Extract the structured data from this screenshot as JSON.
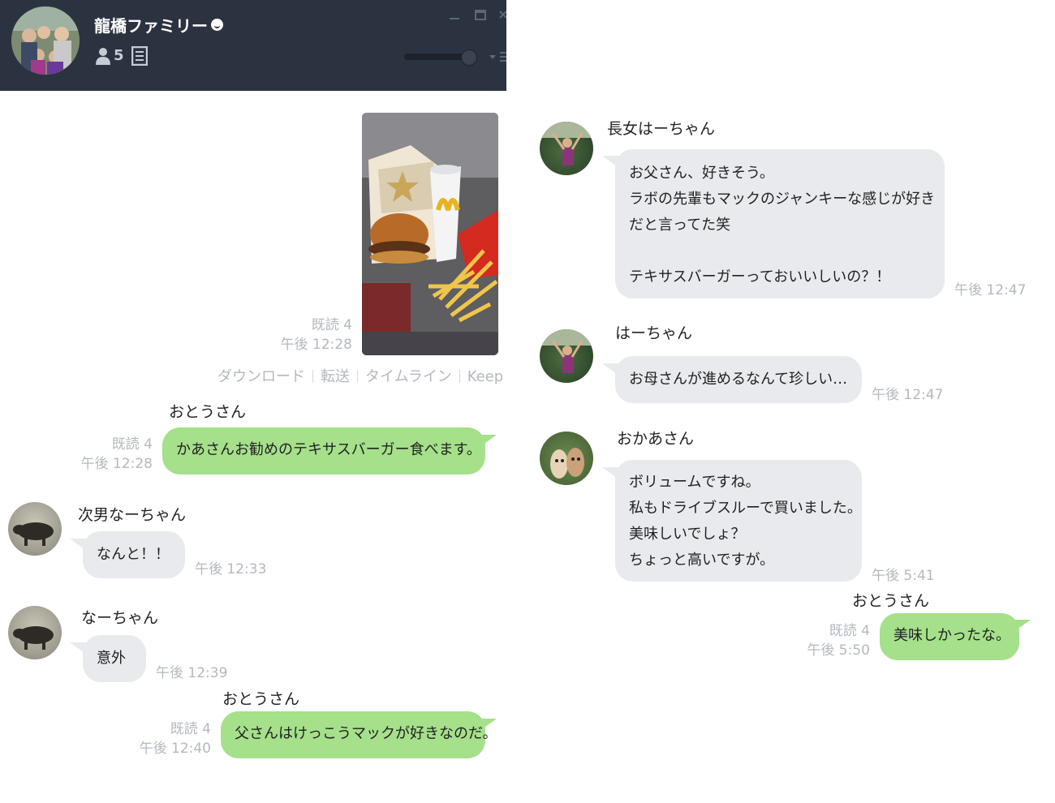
{
  "header": {
    "title": "龍橋ファミリー",
    "member_count": "5"
  },
  "photo_message": {
    "read": "既読 4",
    "time": "午後 12:28",
    "actions": [
      "ダウンロード",
      "転送",
      "タイムライン",
      "Keep"
    ]
  },
  "messages": [
    {
      "sender": "おとうさん",
      "read": "既読 4",
      "time": "午後 12:28",
      "lines": [
        "かあさんお勧めのテキサスバーガー食べます。"
      ]
    },
    {
      "sender": "次男なーちゃん",
      "time": "午後 12:33",
      "lines": [
        "なんと！！"
      ]
    },
    {
      "sender": "なーちゃん",
      "time": "午後 12:39",
      "lines": [
        "意外"
      ]
    },
    {
      "sender": "おとうさん",
      "read": "既読 4",
      "time": "午後 12:40",
      "lines": [
        "父さんはけっこうマックが好きなのだ。"
      ]
    },
    {
      "sender": "長女はーちゃん",
      "time": "午後 12:47",
      "lines": [
        "お父さん、好きそう。",
        "ラボの先輩もマックのジャンキーな感じが好き",
        "だと言ってた笑",
        "",
        "テキサスバーガーっておいいしいの？！"
      ]
    },
    {
      "sender": "はーちゃん",
      "time": "午後 12:47",
      "lines": [
        "お母さんが進めるなんて珍しい…"
      ]
    },
    {
      "sender": "おかあさん",
      "time": "午後 5:41",
      "lines": [
        "ボリュームですね。",
        "私もドライブスルーで買いました。",
        "美味しいでしょ？",
        "ちょっと高いですが。"
      ]
    },
    {
      "sender": "おとうさん",
      "read": "既読 4",
      "time": "午後 5:50",
      "lines": [
        "美味しかったな。"
      ]
    }
  ],
  "colors": {
    "header_bg": "#2c3340",
    "sent_bubble": "#a5e08a",
    "received_bubble": "#e8eaed",
    "meta_text": "#b4b8bf"
  }
}
